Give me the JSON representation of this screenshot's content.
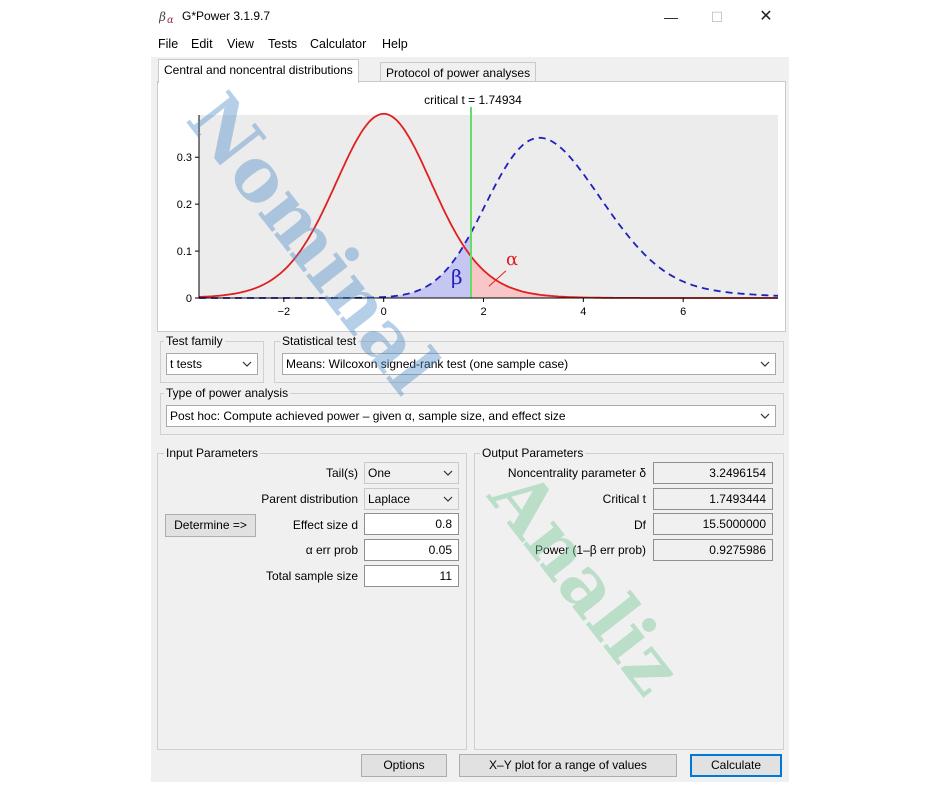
{
  "window": {
    "title": "G*Power 3.1.9.7",
    "controls": {
      "minimize": "—",
      "maximize": "☐",
      "close": "✕"
    }
  },
  "menu": [
    "File",
    "Edit",
    "View",
    "Tests",
    "Calculator",
    "Help"
  ],
  "tabs": [
    {
      "label": "Central and noncentral distributions",
      "active": true
    },
    {
      "label": "Protocol of power analyses",
      "active": false
    }
  ],
  "chart_data": {
    "type": "line",
    "annotation": "critical t = 1.74934",
    "critical_t": 1.74934,
    "x_ticks": [
      "−2",
      "0",
      "2",
      "4",
      "6"
    ],
    "y_ticks": [
      "0",
      "0.1",
      "0.2",
      "0.3"
    ],
    "xlim": [
      -3.7,
      7.9
    ],
    "ylim": [
      0,
      0.39
    ],
    "beta_label": "β",
    "alpha_label": "α",
    "series": [
      {
        "style": "solid",
        "color": "#e02020",
        "distribution": "central t",
        "df": 15.5,
        "ncp": 0
      },
      {
        "style": "dashed",
        "color": "#2020c0",
        "distribution": "noncentral t",
        "df": 15.5,
        "ncp": 3.2496154
      }
    ],
    "colors": {
      "alpha_fill": "#f7c6c6",
      "beta_fill": "#c6c6f2",
      "critical_line": "#66dd66",
      "plot_bg": "#ececec"
    }
  },
  "test_family": {
    "label": "Test family",
    "value": "t tests"
  },
  "statistical_test": {
    "label": "Statistical test",
    "value": "Means: Wilcoxon signed-rank test (one sample case)"
  },
  "power_analysis": {
    "label": "Type of power analysis",
    "value": "Post hoc: Compute achieved power – given α, sample size, and effect size"
  },
  "input": {
    "title": "Input Parameters",
    "tails_label": "Tail(s)",
    "tails_value": "One",
    "parent_label": "Parent distribution",
    "parent_value": "Laplace",
    "determine_label": "Determine =>",
    "effect_label": "Effect size d",
    "effect_value": "0.8",
    "alpha_label": "α err prob",
    "alpha_value": "0.05",
    "n_label": "Total sample size",
    "n_value": "11"
  },
  "output": {
    "title": "Output Parameters",
    "ncp_label": "Noncentrality parameter δ",
    "ncp_value": "3.2496154",
    "crit_label": "Critical t",
    "crit_value": "1.7493444",
    "df_label": "Df",
    "df_value": "15.5000000",
    "power_label": "Power (1–β err prob)",
    "power_value": "0.9275986"
  },
  "buttons": {
    "options": "Options",
    "xy_plot": "X–Y plot for a range of values",
    "calculate": "Calculate"
  },
  "watermark": {
    "line1": "Nominal",
    "line2": "Analiz"
  }
}
